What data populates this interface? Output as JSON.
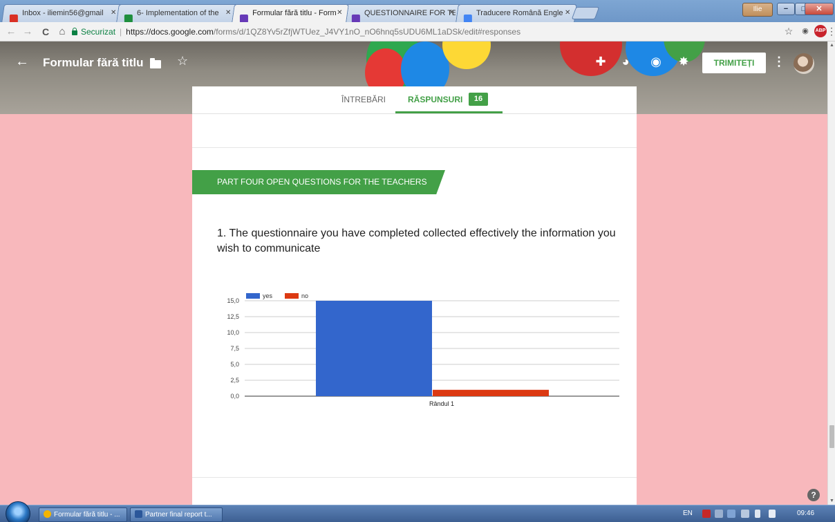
{
  "browser": {
    "tabs": [
      {
        "title": "Inbox - iliemin56@gmail",
        "icon": "gmail-icon",
        "color": "#d93025"
      },
      {
        "title": "6- Implementation of the",
        "icon": "drive-icon",
        "color": "#1e8e3e"
      },
      {
        "title": "Formular fără titlu - Form",
        "icon": "forms-icon",
        "color": "#673ab7",
        "active": true
      },
      {
        "title": "QUESTIONNAIRE FOR TE",
        "icon": "forms-icon",
        "color": "#673ab7"
      },
      {
        "title": "Traducere Română Engle",
        "icon": "translate-icon",
        "color": "#4285f4"
      }
    ],
    "close_glyph": "✕",
    "user_chip": "Ilie",
    "window_buttons": {
      "minimize": "−",
      "maximize": "□",
      "close": "✕"
    },
    "nav": {
      "back": "←",
      "forward": "→",
      "reload": "C",
      "home": "⌂"
    },
    "address": {
      "secure_label": "Securizat",
      "separator": "|",
      "url_host": "https://docs.google.com",
      "url_path": "/forms/d/1QZ8Yv5rZfjWTUez_J4VY1nO_nO6hnq5sUDU6ML1aDSk/edit#responses"
    },
    "toolbar_right": {
      "star": "☆",
      "extension": "◉",
      "abp": "ABP",
      "menu": "⋮"
    }
  },
  "form_header": {
    "back_icon": "←",
    "title": "Formular fără titlu",
    "star_icon": "☆",
    "icons": {
      "addon": "✚",
      "palette": "◕",
      "preview": "◉",
      "settings": "✸"
    },
    "send_label": "TRIMITEȚI",
    "more_icon": "⋮"
  },
  "tabs": {
    "questions_label": "ÎNTREBĂRI",
    "responses_label": "RĂSPUNSURI",
    "responses_count": "16"
  },
  "section": {
    "title": "PART FOUR OPEN QUESTIONS FOR THE TEACHERS"
  },
  "question": {
    "title": "1. The questionnaire you have completed collected effectively the information you wish to communicate"
  },
  "colors": {
    "accent_green": "#43a047",
    "yes_series": "#3366cc",
    "no_series": "#dc3912",
    "background_pink": "#f8b8bc"
  },
  "chart_data": {
    "type": "bar",
    "categories": [
      "Rândul 1"
    ],
    "series": [
      {
        "name": "yes",
        "values": [
          15
        ],
        "color": "#3366cc"
      },
      {
        "name": "no",
        "values": [
          1
        ],
        "color": "#dc3912"
      }
    ],
    "yticks": [
      "0,0",
      "2,5",
      "5,0",
      "7,5",
      "10,0",
      "12,5",
      "15,0"
    ],
    "ylim": [
      0,
      15
    ],
    "grid": true,
    "legend": "top-left"
  },
  "help_icon": "?",
  "taskbar": {
    "buttons": [
      {
        "label": "Formular fără titlu - ...",
        "color": "#f4b400"
      },
      {
        "label": "Partner final report t...",
        "color": "#2b579a"
      }
    ],
    "language": "EN",
    "clock": "09:46"
  },
  "scrollbar": {
    "up": "▲",
    "down": "▼"
  }
}
